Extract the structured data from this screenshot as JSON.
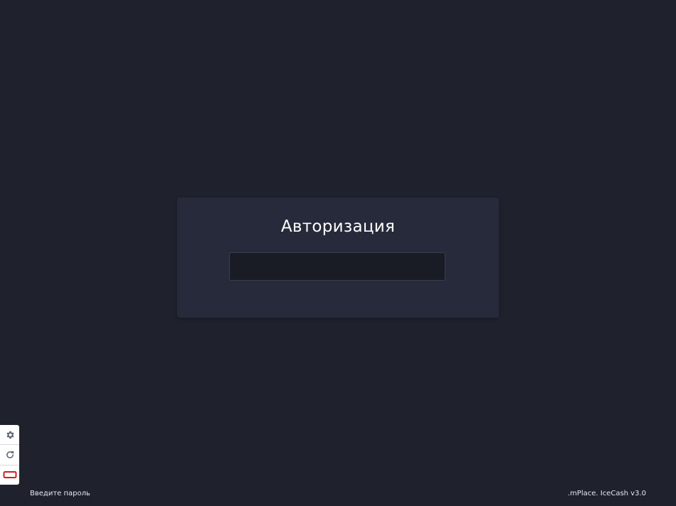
{
  "auth": {
    "title": "Авторизация",
    "password_value": ""
  },
  "toolbar": {
    "items": [
      {
        "icon": "gear-icon"
      },
      {
        "icon": "refresh-icon"
      },
      {
        "icon": "battery-icon"
      }
    ]
  },
  "status": {
    "hint": "Введите пароль",
    "version": ".mPlace. IceCash v3.0"
  },
  "colors": {
    "background": "#1f222d",
    "card": "#262a3a",
    "input": "#191c25",
    "accent_red": "#cc1f1f",
    "icon_gray": "#5b6170"
  }
}
